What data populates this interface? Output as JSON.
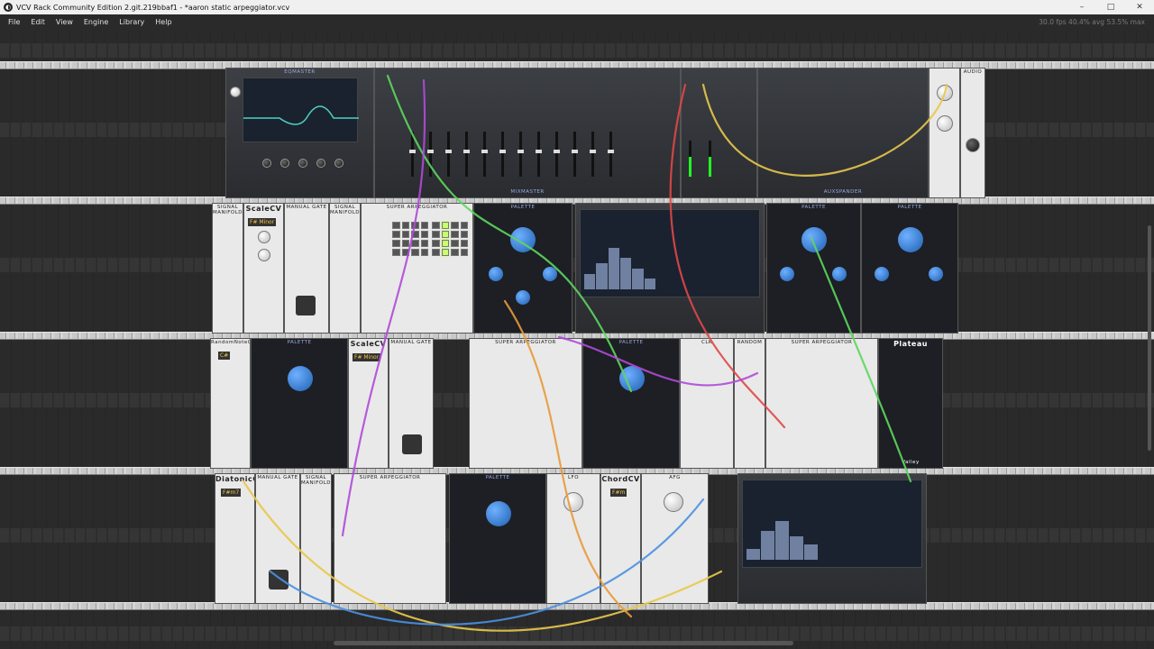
{
  "window": {
    "title": "VCV Rack Community Edition 2.git.219bbaf1 - *aaron static arpeggiator.vcv",
    "minimize": "–",
    "maximize": "□",
    "close": "✕"
  },
  "menu": [
    "File",
    "Edit",
    "View",
    "Engine",
    "Library",
    "Help"
  ],
  "stats": "30.0 fps  40.4% avg  53.5% max",
  "modules": {
    "eqmaster": "EQMASTER",
    "mixmaster": "MIXMASTER",
    "auxspander": "AUXSPANDER",
    "audio": "AUDIO",
    "scalecv_1": "ScaleCV",
    "scalecv_1_key": "F# Minor",
    "manual_gate_1": "MANUAL GATE",
    "signal_manifold_1": "SIGNAL MANIFOLD",
    "signal_manifold_2": "SIGNAL MANIFOLD",
    "super_arp_1": "SUPER ARPEGGIATOR",
    "palette_1": "PALETTE",
    "palette_2": "PALETTE",
    "palette_3": "PALETTE",
    "randomnote": "RandomNoteCV",
    "randomnote_key": "C#",
    "palette_4": "PALETTE",
    "scalecv_2": "ScaleCV",
    "scalecv_2_key": "F# Minor",
    "manual_gate_2": "MANUAL GATE",
    "super_arp_2": "SUPER ARPEGGIATOR",
    "palette_5": "PALETTE",
    "clock": "CLK",
    "random": "RANDOM",
    "super_arp_3": "SUPER ARPEGGIATOR",
    "plateau": "Plateau",
    "valley": "Valley",
    "diatoniccv": "DiatonicCV",
    "diatoniccv_key": "F#m7",
    "manual_gate_3": "MANUAL GATE",
    "signal_manifold_3": "SIGNAL MANIFOLD",
    "super_arp_4": "SUPER ARPEGGIATOR",
    "palette_6": "PALETTE",
    "lfo": "LFO",
    "chordcv": "ChordCV",
    "chordcv_key": "F#m",
    "afg": "AFG",
    "aaron_static": "aaron static"
  },
  "colors": {
    "cable_green": "#5ed65e",
    "cable_purple": "#b04ad8",
    "cable_yellow": "#e8c84a",
    "cable_red": "#e04848",
    "cable_blue": "#4a90e0",
    "cable_orange": "#e89a3a"
  }
}
